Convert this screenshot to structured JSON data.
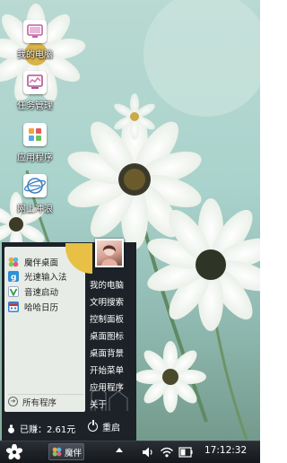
{
  "desktop": {
    "icons": [
      {
        "label": "我的电脑",
        "icon": "computer-icon"
      },
      {
        "label": "任务管理",
        "icon": "task-manager-icon"
      },
      {
        "label": "应用程序",
        "icon": "apps-icon"
      },
      {
        "label": "网上冲浪",
        "icon": "internet-icon"
      }
    ]
  },
  "start_menu": {
    "apps": [
      {
        "label": "魔伴桌面",
        "icon": "mobanzhuomian-icon"
      },
      {
        "label": "光速输入法",
        "icon": "input-method-icon"
      },
      {
        "label": "音速启动",
        "icon": "vstart-icon"
      },
      {
        "label": "哈哈日历",
        "icon": "calendar-icon"
      }
    ],
    "all_programs": "所有程序",
    "shortcuts": [
      "我的电脑",
      "文明搜索",
      "控制面板",
      "桌面图标",
      "桌面背景",
      "开始菜单",
      "应用程序",
      "关于"
    ],
    "coins_label": "已赚：2.61元",
    "restart_label": "重启"
  },
  "taskbar": {
    "task_label": "魔伴",
    "clock": "17:12:32",
    "tray_icons": [
      "volume-icon",
      "wifi-icon",
      "battery-icon"
    ]
  },
  "colors": {
    "menu_bg": "#1d2228",
    "menu_panel": "#e8ece7",
    "accent_yellow": "#e8c045",
    "taskbar_bg": "#14171b"
  }
}
